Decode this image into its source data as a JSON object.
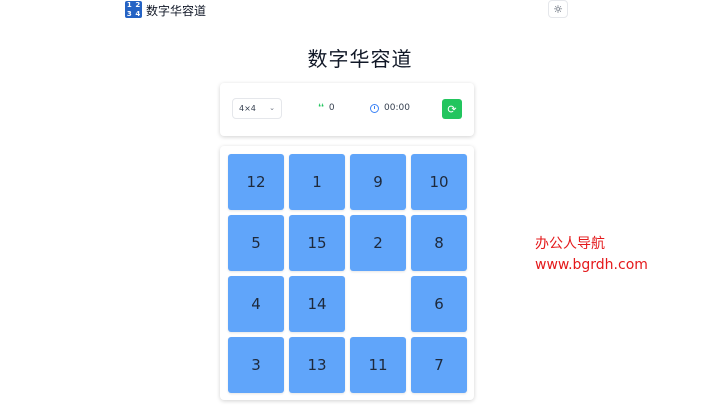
{
  "header": {
    "logo_digits": [
      "1",
      "2",
      "3",
      "4"
    ],
    "app_name": "数字华容道",
    "theme_toggle_icon": "sun-icon"
  },
  "page_title": "数字华容道",
  "controls": {
    "size_select_value": "4×4",
    "moves": "0",
    "time": "00:00",
    "reset_icon": "refresh-icon"
  },
  "board": {
    "size": 4,
    "tiles": [
      [
        "12",
        "1",
        "9",
        "10"
      ],
      [
        "5",
        "15",
        "2",
        "8"
      ],
      [
        "4",
        "14",
        "",
        "6"
      ],
      [
        "3",
        "13",
        "11",
        "7"
      ]
    ],
    "tile_color": "#60a5fa"
  },
  "watermark": {
    "line1": "办公人导航",
    "line2": "www.bgrdh.com",
    "color": "#e4191b"
  }
}
